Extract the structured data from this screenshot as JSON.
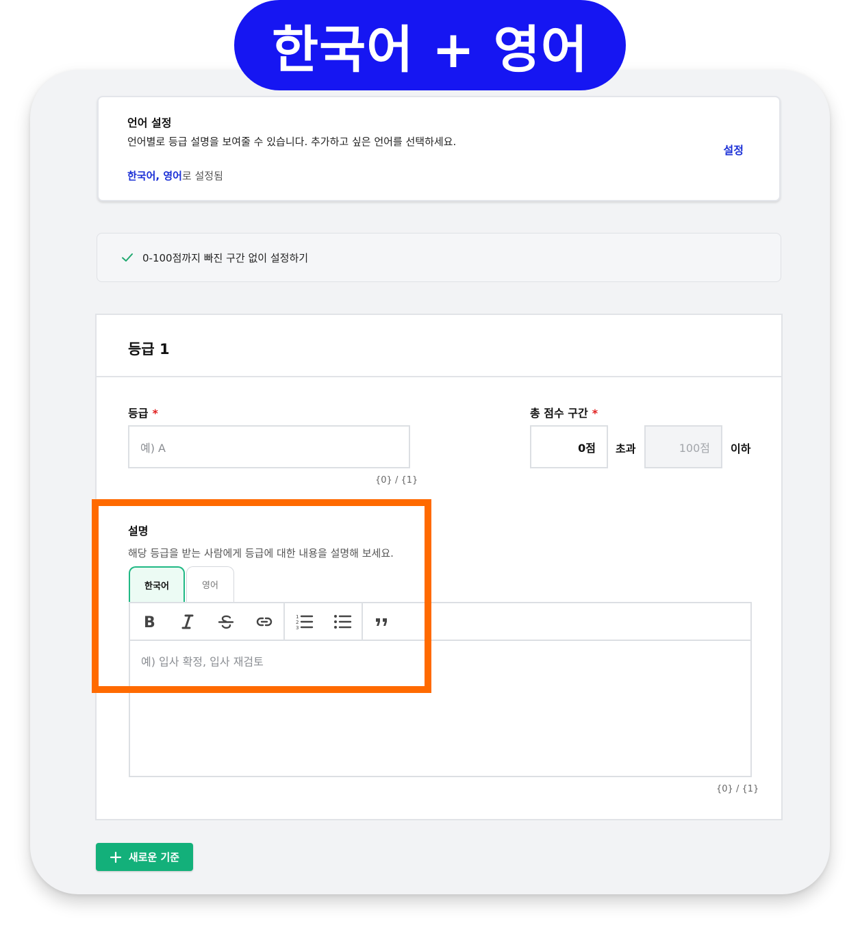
{
  "banner": {
    "title": "한국어 + 영어",
    "color": "#1616f2"
  },
  "language_settings": {
    "title": "언어 설정",
    "description": "언어별로 등급 설명을 보여줄 수 있습니다. 추가하고 싶은 언어를 선택하세요.",
    "selected_languages": "한국어, 영어",
    "selected_suffix": "로 설정됨",
    "settings_link": "설정"
  },
  "option": {
    "label": "0-100점까지 빠진 구간 없이 설정하기",
    "checked": true
  },
  "grade_panel": {
    "title": "등급 1",
    "grade_field": {
      "label": "등급",
      "required_mark": "*",
      "placeholder": "예) A",
      "counter": "{0} / {1}"
    },
    "score_range": {
      "label": "총 점수 구간",
      "required_mark": "*",
      "from_value": "0점",
      "from_word": "초과",
      "to_value": "100점",
      "to_word": "이하"
    },
    "description": {
      "label": "설명",
      "help": "해당 등급을 받는 사람에게 등급에 대한 내용을 설명해 보세요.",
      "tabs": [
        {
          "label": "한국어",
          "active": true
        },
        {
          "label": "영어",
          "active": false
        }
      ],
      "toolbar": [
        "bold-icon",
        "italic-icon",
        "strikethrough-icon",
        "link-icon",
        "ordered-list-icon",
        "bullet-list-icon",
        "quote-icon"
      ],
      "placeholder": "예) 입사 확정, 입사 재검토",
      "counter": "{0} / {1}"
    }
  },
  "new_criterion_button": {
    "label": "새로운 기준",
    "color": "#13b07a"
  },
  "highlight_color": "#ff6a00"
}
